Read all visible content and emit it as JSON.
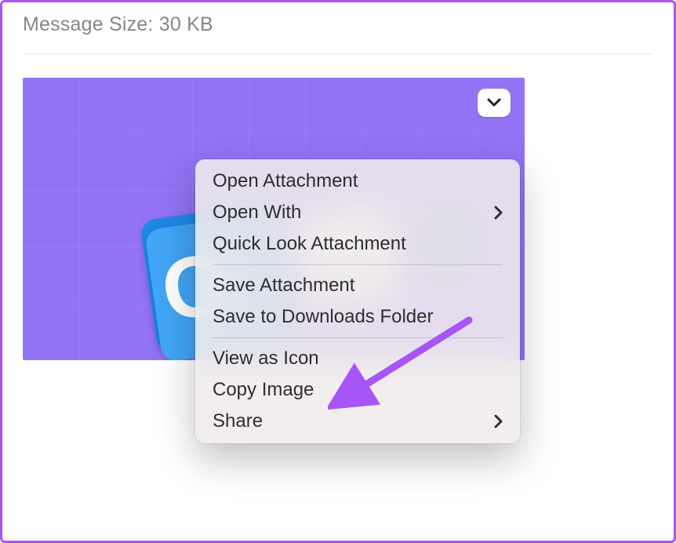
{
  "header": {
    "message_size_label": "Message Size: 30 KB"
  },
  "attachment": {
    "outlook_letter": "O"
  },
  "menu": {
    "open_attachment": "Open Attachment",
    "open_with": "Open With",
    "quick_look": "Quick Look Attachment",
    "save_attachment": "Save Attachment",
    "save_to_downloads": "Save to Downloads Folder",
    "view_as_icon": "View as Icon",
    "copy_image": "Copy Image",
    "share": "Share"
  }
}
